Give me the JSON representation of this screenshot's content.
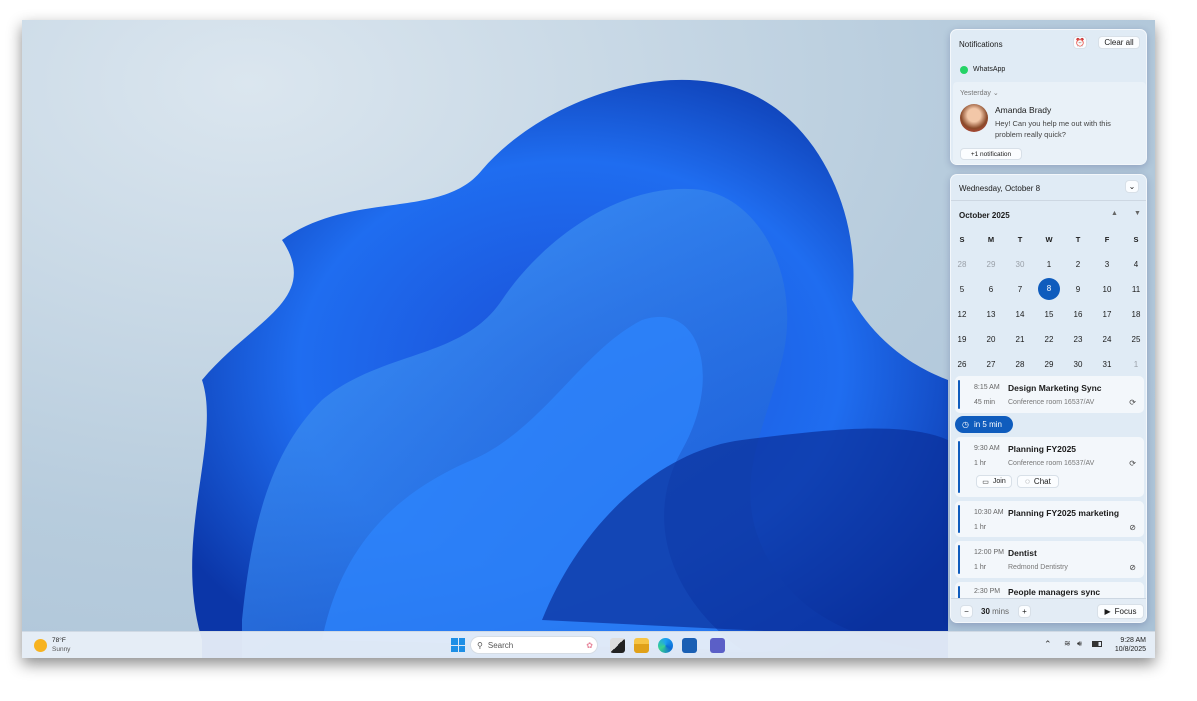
{
  "notifications": {
    "title": "Notifications",
    "clear_all": "Clear all",
    "app": "WhatsApp",
    "group_label": "Yesterday",
    "sender": "Amanda Brady",
    "message": "Hey! Can you help me out with this problem really quick?",
    "more": "+1 notification"
  },
  "calendar": {
    "date_header": "Wednesday, October 8",
    "month": "October 2025",
    "weekdays": [
      "S",
      "M",
      "T",
      "W",
      "T",
      "F",
      "S"
    ],
    "weeks": [
      [
        "28",
        "29",
        "30",
        "1",
        "2",
        "3",
        "4"
      ],
      [
        "5",
        "6",
        "7",
        "8",
        "9",
        "10",
        "11"
      ],
      [
        "12",
        "13",
        "14",
        "15",
        "16",
        "17",
        "18"
      ],
      [
        "19",
        "20",
        "21",
        "22",
        "23",
        "24",
        "25"
      ],
      [
        "26",
        "27",
        "28",
        "29",
        "30",
        "31",
        "1"
      ]
    ],
    "selected": "8"
  },
  "events": [
    {
      "time": "8:15 AM",
      "title": "Design Marketing Sync",
      "duration": "45 min",
      "location": "Conference room 16537/AV"
    },
    {
      "time": "9:30 AM",
      "title": "Planning FY2025",
      "duration": "1 hr",
      "location": "Conference room 16537/AV",
      "join": "Join",
      "chat": "Chat"
    },
    {
      "time": "10:30 AM",
      "title": "Planning FY2025 marketing",
      "duration": "1 hr",
      "location": ""
    },
    {
      "time": "12:00 PM",
      "title": "Dentist",
      "duration": "1 hr",
      "location": "Redmond Dentistry"
    },
    {
      "time": "2:30 PM",
      "title": "People managers sync"
    }
  ],
  "upcoming_badge": "in 5 min",
  "focus": {
    "value": "30",
    "unit": "mins",
    "button": "Focus"
  },
  "taskbar": {
    "temp": "78°F",
    "condition": "Sunny",
    "search_placeholder": "Search",
    "time": "9:28 AM",
    "date": "10/8/2025"
  },
  "colors": {
    "accent": "#0f5cbd"
  }
}
